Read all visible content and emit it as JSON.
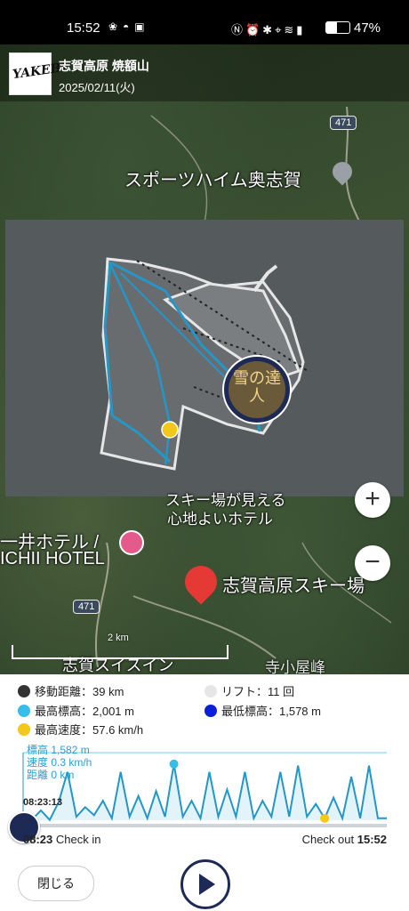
{
  "status_bar": {
    "time": "15:52",
    "battery_pct_text": "47%",
    "battery_level": 0.47
  },
  "header": {
    "logo_text": "YAKEBI",
    "resort_name": "志賀高原 焼額山",
    "date": "2025/02/11(火)"
  },
  "map": {
    "labels": {
      "sports_heim": "スポーツハイム奥志賀",
      "hotel_view": "スキー場が見える",
      "hotel_view2": "心地よいホテル",
      "ichii_jp": "一井ホテル /",
      "ichii_en": "ICHII HOTEL",
      "shiga_ski": "志賀高原スキー場",
      "swiss_inn": "志賀スイスイン",
      "road_shield_top": "471",
      "road_shield_bottom": "471",
      "partial_right": "寺小屋峰"
    },
    "scale_label": "2 km",
    "badge_text": "雪の達人"
  },
  "zoom": {
    "in_label": "+",
    "out_label": "−"
  },
  "stats": {
    "distance": "移動距離：39 km",
    "lifts": "リフト：11 回",
    "max_elevation": "最高標高：2,001 m",
    "min_elevation": "最低標高：1,578 m",
    "max_speed": "最高速度：57.6 km/h"
  },
  "colors": {
    "distance": "#333333",
    "lifts": "#e6e6e6",
    "max_elevation": "#37bdea",
    "min_elevation": "#0b1fd6",
    "max_speed": "#f2c918",
    "track": "#2596c8",
    "accent_dark": "#1d2a55"
  },
  "chart_info": {
    "elevation": "標高 1,582 m",
    "speed": "速度 0.3 km/h",
    "distance": "距離 0 km",
    "cursor_time": "08:23:13"
  },
  "footer": {
    "checkin_time": "08:23",
    "checkin_label": "Check in",
    "checkout_label": "Check out",
    "checkout_time": "15:52",
    "close_label": "閉じる",
    "play_icon": "play-icon"
  },
  "chart_data": {
    "type": "area",
    "title": "",
    "xlabel": "",
    "ylabel": "",
    "x_range": [
      "08:23",
      "15:52"
    ],
    "ylim": [
      1578,
      2001
    ],
    "values": [
      1582,
      1582,
      1640,
      1580,
      1690,
      1880,
      1600,
      1660,
      1610,
      1700,
      1590,
      1880,
      1600,
      1730,
      1590,
      1760,
      1600,
      1930,
      1600,
      1700,
      1590,
      1880,
      1600,
      1770,
      1600,
      1880,
      1590,
      1700,
      1600,
      1880,
      1600,
      1920,
      1600,
      1680,
      1590,
      1720,
      1590,
      1850,
      1590,
      1920,
      1590,
      1590
    ],
    "markers": [
      {
        "type": "max_elevation",
        "index": 17
      },
      {
        "type": "max_speed",
        "index": 34
      },
      {
        "type": "min_elevation",
        "index": 1
      }
    ]
  }
}
